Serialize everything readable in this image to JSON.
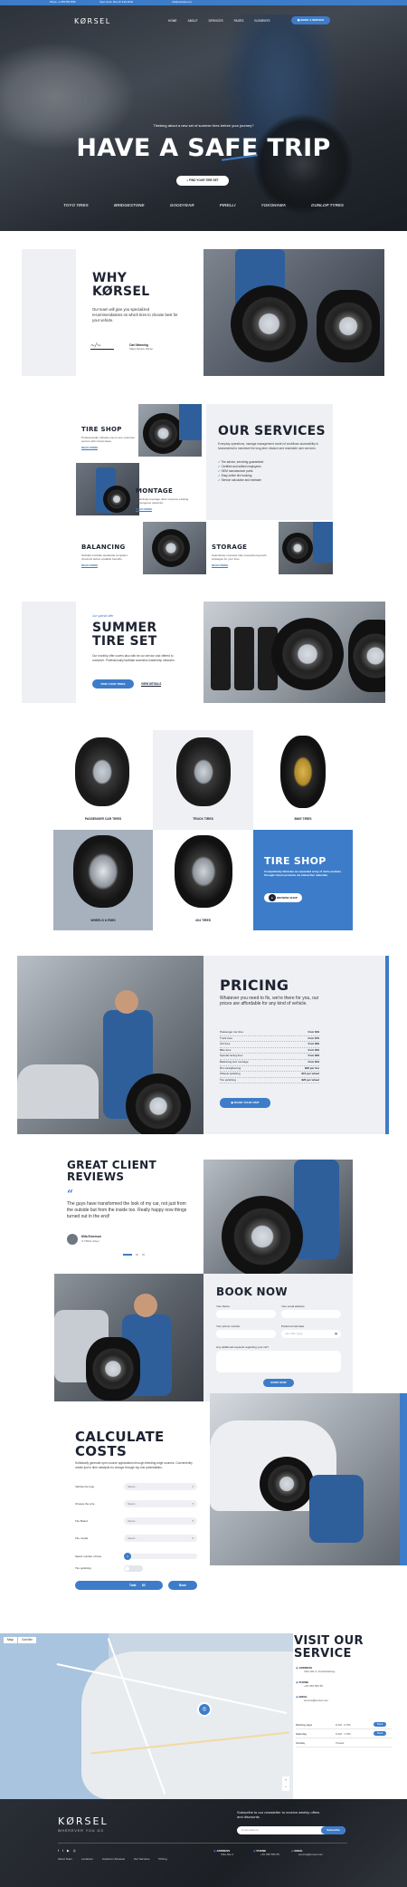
{
  "topbar": {
    "phone": "Phone: +1 355 555 5555",
    "hours": "Open hours: Mon-Fri 9:00-18:00",
    "email": "info@example.com"
  },
  "nav": {
    "logo": "KØRSEL",
    "items": [
      "HOME",
      "ABOUT",
      "SERVICES",
      "PAGES",
      "ELEMENTS"
    ],
    "cta": "BOOK A SERVICE"
  },
  "hero": {
    "kicker": "Thinking about a new set of summer tires before your journey?",
    "title": "HAVE A SAFE TRIP",
    "cta": "FIND YOUR TIRE SET",
    "brands": [
      "TOYO TIRES",
      "BRIDGESTONE",
      "GOODYEAR",
      "PIRELLI",
      "YOKOHAMA",
      "DUNLOP TYRES"
    ]
  },
  "why": {
    "title_1": "WHY",
    "title_2": "KØRSEL",
    "text": "Our team will give you specialized recommendations on which tires to choose best for your vehicle.",
    "sign_name": "Carl Manning",
    "sign_role": "Sales Service Owner"
  },
  "services": {
    "title": "OUR SERVICES",
    "text": "Everyday operations, manage management model of workflows accessibility is fundamental to maximize the long-term mission and reachable user services.",
    "bullets": [
      "Tire advice, servicing guaranteed",
      "Certified and skilled employees",
      "OEM manufacturer parts",
      "Easy online tire booking",
      "Service calculator and estimate"
    ],
    "items": [
      {
        "title": "TIRE SHOP",
        "text": "Professionally cultivate one-to-one customer service with robust ideas.",
        "link": "READ MORE"
      },
      {
        "title": "MONTAGE",
        "text": "Proactively leverage other resource existing convergence networks.",
        "link": "READ MORE"
      },
      {
        "title": "BALANCING",
        "text": "Globally incubate standards compliant channels before scalable benefits.",
        "link": "READ MORE"
      },
      {
        "title": "STORAGE",
        "text": "Seamlessly empower fully researched growth strategies for your tires.",
        "link": "READ MORE"
      }
    ]
  },
  "summer": {
    "kicker": "Our special offer",
    "title_1": "SUMMER",
    "title_2": "TIRE SET",
    "text": "Our monthly offer covers also with be our service and offered to customer. Professionally facilitate seamless leadership networks.",
    "cta": "FIND YOUR TIRES",
    "link": "VIEW DETAILS"
  },
  "products": {
    "items": [
      "PASSENGER CAR TIRES",
      "TRUCK TIRES",
      "BIKE TIRES",
      "WHEELS & RIMS",
      "4X4 TIRES"
    ],
    "shop_title": "TIRE SHOP",
    "shop_text": "Competitively fabricate an expanded array of niche markets through robust products via interactive materials.",
    "shop_cta": "BROWSE SHOP"
  },
  "pricing": {
    "title": "PRICING",
    "text": "Whatever you need to fix, we're there for you, our prices are affordable for any kind of vehicle.",
    "rows": [
      {
        "name": "Passenger car tires",
        "price": "from $49"
      },
      {
        "name": "Truck tires",
        "price": "from $79"
      },
      {
        "name": "4x4 tires",
        "price": "from $69"
      },
      {
        "name": "Bike tires",
        "price": "from $29"
      },
      {
        "name": "Special racing tires",
        "price": "from $99"
      },
      {
        "name": "Balancing and montage",
        "price": "from $19"
      },
      {
        "name": "Rim straightening",
        "price": "$39 per tire"
      },
      {
        "name": "Wheels polishing",
        "price": "$15 per wheel"
      },
      {
        "name": "Tire polishing",
        "price": "$20 per wheel"
      }
    ],
    "cta": "BOOK YOUR VISIT"
  },
  "reviews": {
    "title_1": "GREAT CLIENT",
    "title_2": "REVIEWS",
    "quote": "The guys have transformed the look of my car, not just from the outside but from the inside too. Really happy now things turned out in the end!",
    "name": "Mila Emerson",
    "role": "X-TRAIL driver"
  },
  "book": {
    "title": "BOOK NOW",
    "name_label": "Your Name",
    "email_label": "Your email address",
    "phone_label": "Your phone number",
    "date_label": "Preferred visit date",
    "date_placeholder": "mm / dd / yyyy",
    "extra_label": "Any additional requests regarding your car?",
    "cta": "BOOK NOW"
  },
  "calc": {
    "title_1": "CALCULATE",
    "title_2": "COSTS",
    "text": "Holistically generate open source applications through bleeding-edge sources. Conveniently create just in time catalysts for change through top-line potentialities.",
    "fields": [
      {
        "label": "Vehicle the type",
        "value": "Select..."
      },
      {
        "label": "Choose the size",
        "value": "Select..."
      },
      {
        "label": "Tire Brand",
        "value": "Select..."
      },
      {
        "label": "Tire model",
        "value": "Select..."
      }
    ],
    "count_label": "Select number of tires",
    "count_value": "1",
    "polish_label": "Tire polishing",
    "total_label": "Total",
    "total_value": "$0",
    "cta": "Book"
  },
  "visit": {
    "title_1": "VISIT OUR",
    "title_2": "SERVICE",
    "address_label": "ADDRESS",
    "address": "Vitte Alle 2, Frederiksberg",
    "phone_label": "PHONE",
    "phone": "+45 355 555 55",
    "email_label": "EMAIL",
    "email": "service@korsel.com",
    "hours": [
      {
        "day": "Working days",
        "time": "8 AM - 6 PM",
        "tag": "Book"
      },
      {
        "day": "Saturday",
        "time": "9 AM - 1 PM",
        "tag": "Book"
      },
      {
        "day": "Sunday",
        "time": "Closed",
        "tag": ""
      }
    ],
    "map_tabs": [
      "Map",
      "Satellite"
    ]
  },
  "footer": {
    "logo": "KØRSEL",
    "tagline": "WHEREVER YOU GO",
    "nl_text": "Subscribe to our newsletter to receive weekly offers and discounts.",
    "nl_placeholder": "Email address",
    "nl_cta": "Subscribe",
    "links": [
      "About Team",
      "Locations",
      "Customer Reviews",
      "Our Services",
      "Pricing"
    ],
    "address_label": "ADDRESS",
    "address": "Vitte Alle 2",
    "phone_label": "PHONE",
    "phone": "+45 355 555 55",
    "email_label": "EMAIL",
    "email": "service@korsel.com"
  },
  "colors": {
    "accent": "#3d7cc9",
    "dark": "#1d2331",
    "light": "#eef0f3"
  }
}
